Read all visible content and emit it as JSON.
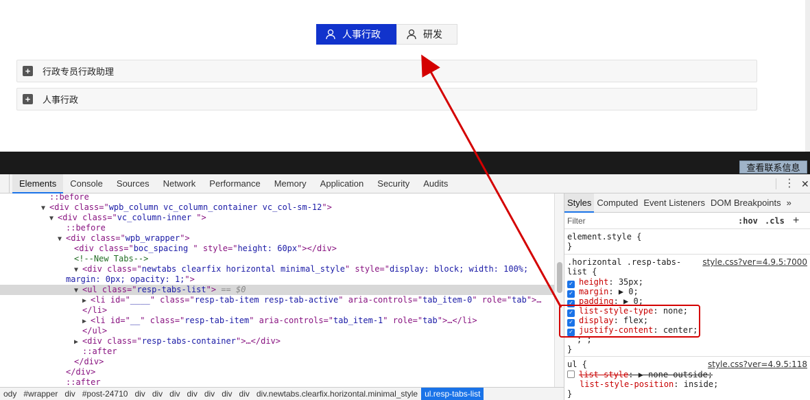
{
  "page": {
    "tabs": [
      {
        "label": "人事行政",
        "active": true
      },
      {
        "label": "研发",
        "active": false
      }
    ],
    "accordion": [
      {
        "label": "行政专员行政助理"
      },
      {
        "label": "人事行政"
      }
    ],
    "contact_button": "查看联系信息"
  },
  "devtools": {
    "tabs": [
      "Elements",
      "Console",
      "Sources",
      "Network",
      "Performance",
      "Memory",
      "Application",
      "Security",
      "Audits"
    ],
    "kebab": "⋮",
    "close": "✕",
    "elements": {
      "l0": "::before",
      "l1a": "<div class=\"",
      "l1b": "wpb_column vc_column_container vc_col-sm-12",
      "l1c": "\">",
      "l2a": "<div class=\"",
      "l2b": "vc_column-inner ",
      "l2c": "\">",
      "l3": "::before",
      "l4a": "<div class=\"",
      "l4b": "wpb_wrapper",
      "l4c": "\">",
      "l5a": "<div class=\"",
      "l5b": "boc_spacing ",
      "l5c": "\" style=\"",
      "l5d": "height: 60px",
      "l5e": "\"></div>",
      "l6": "<!--New Tabs-->",
      "l7a": "<div class=\"",
      "l7b": "newtabs clearfix horizontal  minimal_style",
      "l7c": "\" style=\"",
      "l7d": "display: block; width: 100%;",
      "l8a": "margin: 0px; opacity: 1;",
      "l8b": "\">",
      "l9a": "<ul class=\"",
      "l9b": "resp-tabs-list",
      "l9c": "\">",
      "l9d": " == $0",
      "l10a": "<li id=\"",
      "l10b": "____",
      "l10c": "\" class=\"",
      "l10d": "resp-tab-item resp-tab-active",
      "l10e": "\" aria-controls=\"",
      "l10f": "tab_item-0",
      "l10g": "\" role=\"",
      "l10h": "tab",
      "l10i": "\">…",
      "l11": "</li>",
      "l12a": "<li id=\"",
      "l12b": "__",
      "l12c": "\" class=\"",
      "l12d": "resp-tab-item",
      "l12e": "\" aria-controls=\"",
      "l12f": "tab_item-1",
      "l12g": "\" role=\"",
      "l12h": "tab",
      "l12i": "\">…</li>",
      "l13": "</ul>",
      "l14a": "<div class=\"",
      "l14b": "resp-tabs-container",
      "l14c": "\">…</div>",
      "l15": "::after",
      "l16": "</div>",
      "l17": "</div>",
      "l18": "::after"
    },
    "breadcrumbs": [
      "ody",
      "#wrapper",
      "div",
      "#post-24710",
      "div",
      "div",
      "div",
      "div",
      "div",
      "div",
      "div",
      "div.newtabs.clearfix.horizontal.minimal_style",
      "ul.resp-tabs-list"
    ],
    "styles": {
      "tabs": [
        "Styles",
        "Computed",
        "Event Listeners",
        "DOM Breakpoints",
        "»"
      ],
      "filter_placeholder": "Filter",
      "hov": ":hov",
      "cls": ".cls",
      "add": "+",
      "element_style": "element.style {",
      "close_brace": "}",
      "rule1_selector_a": ".horizontal .resp-tabs-",
      "rule1_selector_b": "list {",
      "rule1_source": "style.css?ver=4.9.5:7000",
      "rule1_props": [
        {
          "name": "height",
          "value": "35px;"
        },
        {
          "name": "margin",
          "value": "▶ 0;"
        },
        {
          "name": "padding",
          "value": "▶ 0;"
        },
        {
          "name": "list-style-type",
          "value": "none;"
        },
        {
          "name": "display",
          "value": "flex;"
        },
        {
          "name": "justify-content",
          "value": "center;"
        }
      ],
      "rule1_extra": "; ;",
      "rule2_selector": "ul {",
      "rule2_source": "style.css?ver=4.9.5:118",
      "rule2_props": [
        {
          "name": "list-style",
          "value": "▶ none outside;"
        },
        {
          "name": "list-style-position",
          "value": "inside;"
        }
      ]
    }
  },
  "colors": {
    "active_tab": "#1133cc",
    "annotation": "#d40000",
    "selection": "#1a73e8"
  }
}
